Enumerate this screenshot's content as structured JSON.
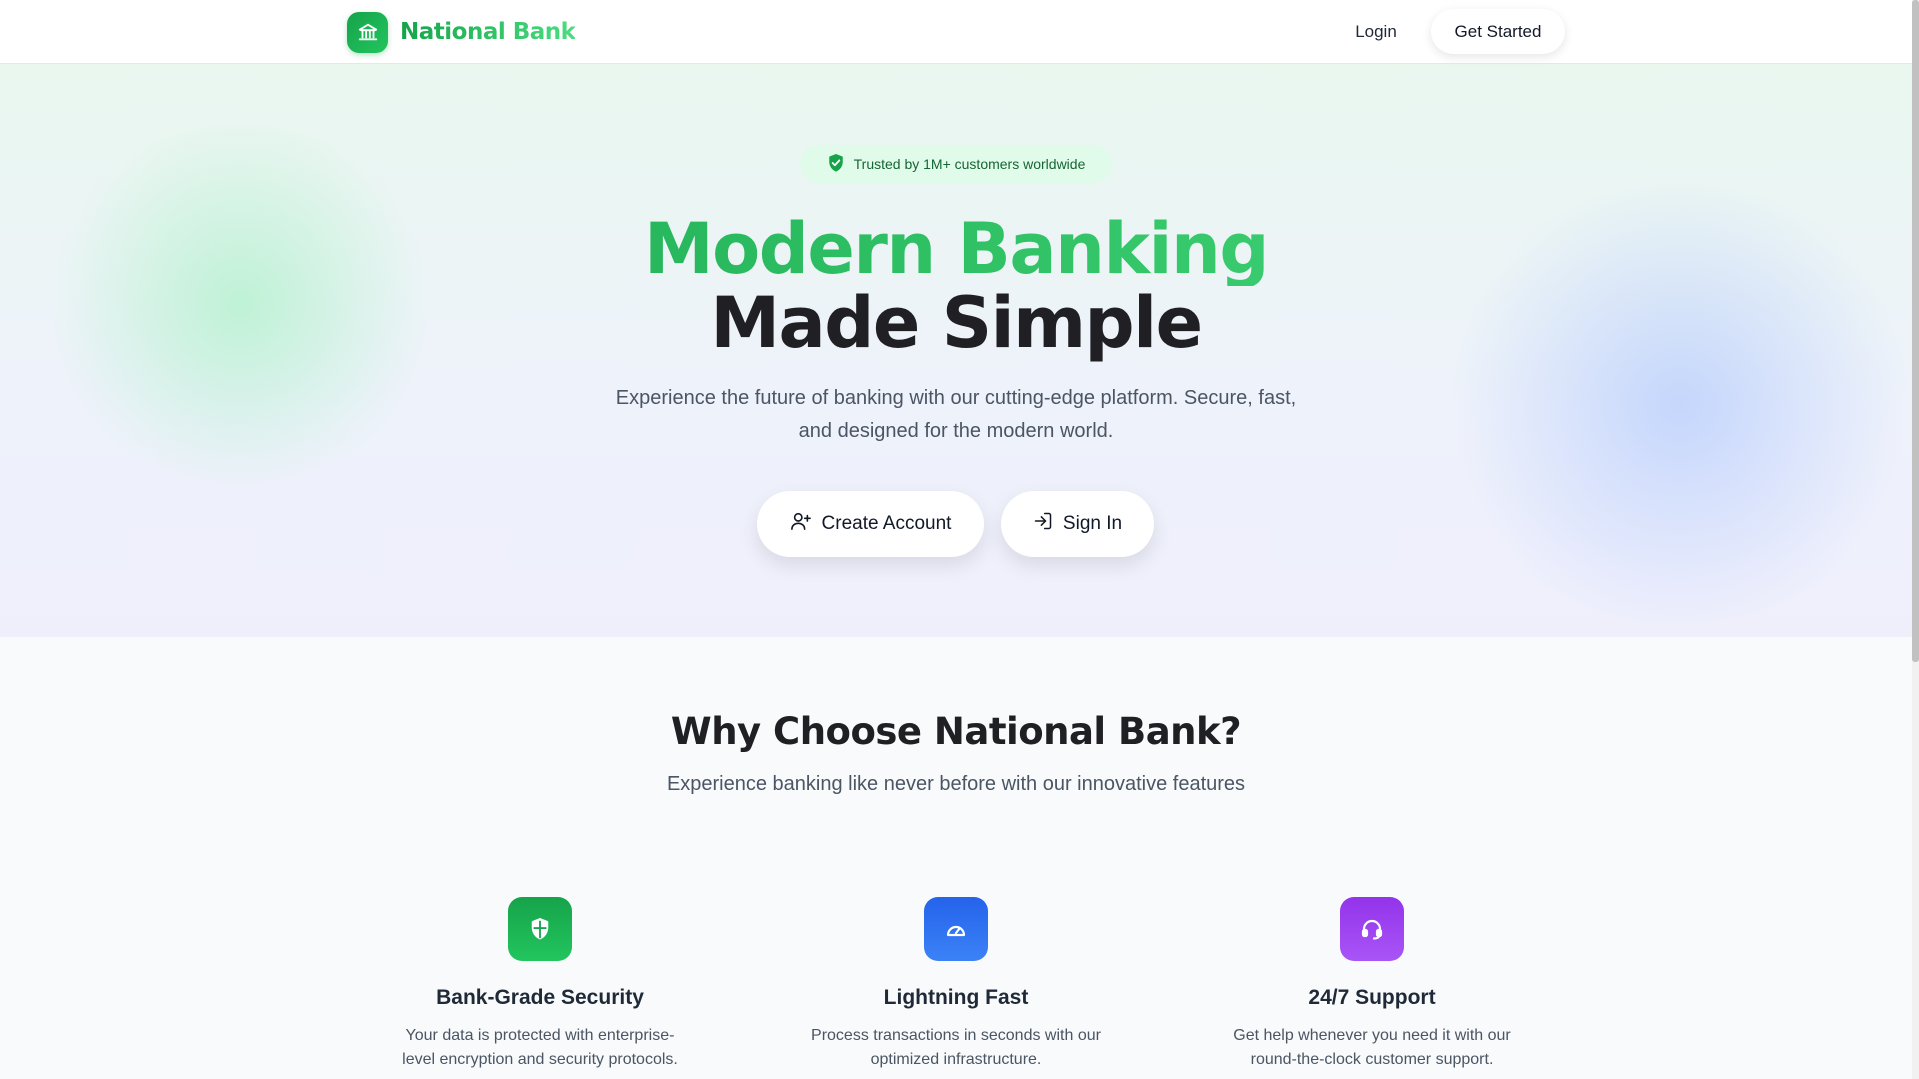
{
  "header": {
    "brand_name": "National Bank",
    "brand_icon": "bank-icon",
    "login_label": "Login",
    "get_started_label": "Get Started"
  },
  "hero": {
    "badge_icon": "shield-check-icon",
    "badge_text": "Trusted by 1M+ customers worldwide",
    "title_line1": "Modern Banking",
    "title_line2": "Made Simple",
    "subtitle_line1": "Experience the future of banking with our cutting-edge platform. Secure, fast,",
    "subtitle_line2": "and designed for the modern world.",
    "create_account_label": "Create Account",
    "create_account_icon": "user-plus-icon",
    "sign_in_label": "Sign In",
    "sign_in_icon": "sign-in-icon"
  },
  "features": {
    "title": "Why Choose National Bank?",
    "subtitle": "Experience banking like never before with our innovative features",
    "items": [
      {
        "icon": "shield-icon",
        "color": "#16a34a",
        "title": "Bank-Grade Security",
        "desc_line1": "Your data is protected with enterprise-",
        "desc_line2": "level encryption and security protocols."
      },
      {
        "icon": "speedometer-icon",
        "color": "#2563eb",
        "title": "Lightning Fast",
        "desc_line1": "Process transactions in seconds with our",
        "desc_line2": "optimized infrastructure."
      },
      {
        "icon": "headset-icon",
        "color": "#9333ea",
        "title": "24/7 Support",
        "desc_line1": "Get help whenever you need it with our",
        "desc_line2": "round-the-clock customer support."
      }
    ]
  },
  "colors": {
    "brand_green": "#16a34a",
    "brand_green_light": "#4ade80",
    "feature_blue": "#2563eb",
    "feature_purple": "#9333ea"
  }
}
